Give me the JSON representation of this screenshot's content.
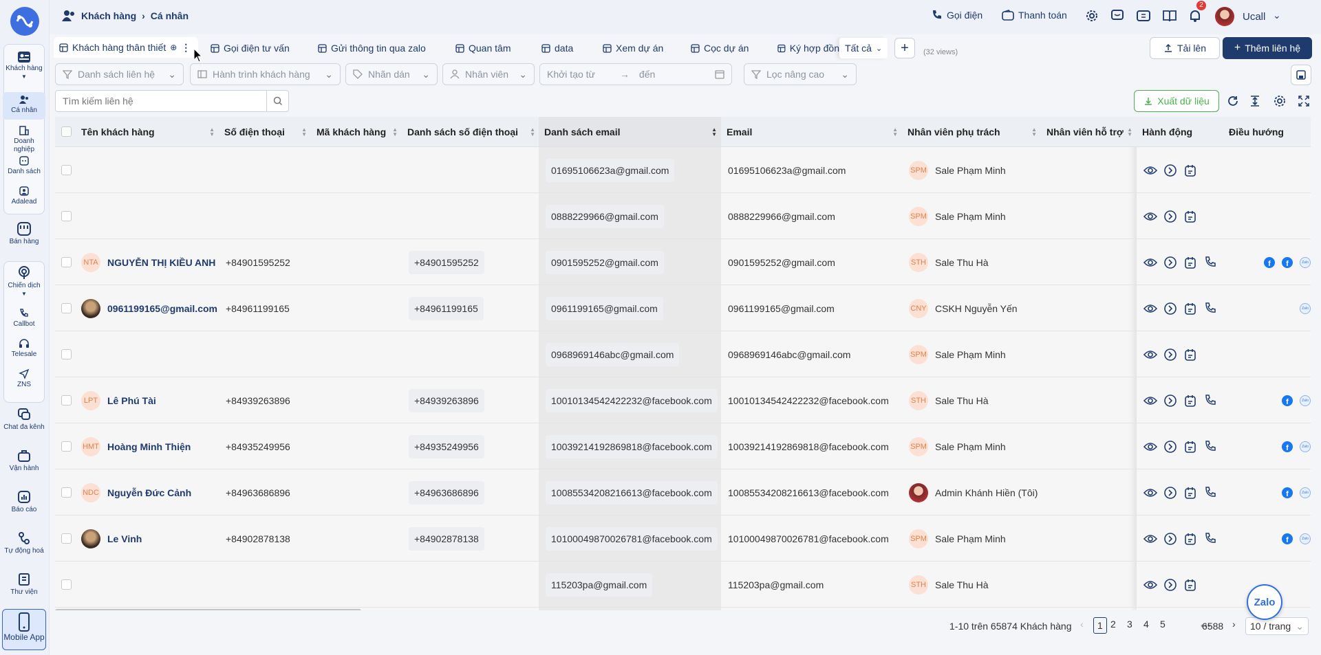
{
  "sidebar": {
    "items": [
      {
        "label": "Khách hàng",
        "icon": "contact-card-icon"
      },
      {
        "label": "Cá nhân",
        "icon": "user-icon"
      },
      {
        "label": "Doanh nghiệp",
        "icon": "building-icon"
      },
      {
        "label": "Danh sách",
        "icon": "list-icon"
      },
      {
        "label": "Adalead",
        "icon": "adalead-icon"
      },
      {
        "label": "Bán hàng",
        "icon": "shop-icon"
      },
      {
        "label": "Chiến dịch",
        "icon": "campaign-icon"
      },
      {
        "label": "Callbot",
        "icon": "phone-icon"
      },
      {
        "label": "Telesale",
        "icon": "headset-icon"
      },
      {
        "label": "ZNS",
        "icon": "send-icon"
      },
      {
        "label": "Chat đa kênh",
        "icon": "chat-icon"
      },
      {
        "label": "Vận hành",
        "icon": "briefcase-icon"
      },
      {
        "label": "Báo cáo",
        "icon": "report-icon"
      },
      {
        "label": "Tự động hoá",
        "icon": "automation-icon"
      },
      {
        "label": "Thư viện",
        "icon": "library-icon"
      },
      {
        "label": "Mobile App",
        "icon": "mobile-icon"
      }
    ]
  },
  "header": {
    "breadcrumb_root": "Khách hàng",
    "breadcrumb_current": "Cá nhân",
    "call_label": "Gọi điện",
    "payment_label": "Thanh toán",
    "notification_count": "2",
    "user_name": "Ucall"
  },
  "tabs": [
    {
      "label": "Khách hàng thân thiết"
    },
    {
      "label": "Gọi điện tư vấn"
    },
    {
      "label": "Gửi thông tin qua zalo"
    },
    {
      "label": "Quan tâm"
    },
    {
      "label": "data"
    },
    {
      "label": "Xem dự án"
    },
    {
      "label": "Cọc dự án"
    },
    {
      "label": "Ký hợp đồn"
    }
  ],
  "tabs_all_label": "Tất cả",
  "views_count": "(32 views)",
  "upload_label": "Tải lên",
  "add_contact_label": "Thêm liên hệ",
  "filters": {
    "contact_list": "Danh sách liên hệ",
    "journey": "Hành trình khách hàng",
    "tags": "Nhãn dán",
    "staff": "Nhân viên",
    "created_from": "Khởi tạo từ",
    "created_to": "đến",
    "advanced": "Lọc nâng cao"
  },
  "search": {
    "placeholder": "Tìm kiếm liên hệ"
  },
  "export_label": "Xuất dữ liệu",
  "columns": [
    "Tên khách hàng",
    "Số điện thoại",
    "Mã khách hàng",
    "Danh sách số điện thoại",
    "Danh sách email",
    "Email",
    "Nhân viên phụ trách",
    "Nhân viên hỗ trợ",
    "Hành động",
    "Điều hướng"
  ],
  "rows": [
    {
      "name": "",
      "initials": "",
      "phone": "",
      "phone_list": "",
      "email_list": "01695106623a@gmail.com",
      "email": "01695106623a@gmail.com",
      "staff_initials": "SPM",
      "staff": "Sale Phạm Minh",
      "call": false,
      "nav": ""
    },
    {
      "name": "",
      "initials": "",
      "phone": "",
      "phone_list": "",
      "email_list": "0888229966@gmail.com",
      "email": "0888229966@gmail.com",
      "staff_initials": "SPM",
      "staff": "Sale Phạm Minh",
      "call": false,
      "nav": ""
    },
    {
      "name": "NGUYỄN THỊ KIỀU ANH",
      "initials": "NTA",
      "phone": "+84901595252",
      "phone_list": "+84901595252",
      "email_list": "0901595252@gmail.com",
      "email": "0901595252@gmail.com",
      "staff_initials": "STH",
      "staff": "Sale Thu Hà",
      "call": true,
      "nav": "fb2"
    },
    {
      "name": "0961199165@gmail.com",
      "initials": "photo",
      "phone": "+84961199165",
      "phone_list": "+84961199165",
      "email_list": "0961199165@gmail.com",
      "email": "0961199165@gmail.com",
      "staff_initials": "CNY",
      "staff": "CSKH Nguyễn Yến",
      "call": true,
      "nav": "zalo"
    },
    {
      "name": "",
      "initials": "",
      "phone": "",
      "phone_list": "",
      "email_list": "0968969146abc@gmail.com",
      "email": "0968969146abc@gmail.com",
      "staff_initials": "SPM",
      "staff": "Sale Phạm Minh",
      "call": false,
      "nav": ""
    },
    {
      "name": "Lê Phú Tài",
      "initials": "LPT",
      "phone": "+84939263896",
      "phone_list": "+84939263896",
      "email_list": "100101345424222 32@facebook.com",
      "email": "10010134542422232@facebook.com",
      "staff_initials": "STH",
      "staff": "Sale Thu Hà",
      "call": true,
      "nav": "fbzalo"
    },
    {
      "name": "Hoàng Minh Thiện",
      "initials": "HMT",
      "phone": "+84935249956",
      "phone_list": "+84935249956",
      "email_list": "10039214192869818@facebook.com",
      "email": "10039214192869818@facebook.com",
      "staff_initials": "SPM",
      "staff": "Sale Phạm Minh",
      "call": true,
      "nav": "fbzalo"
    },
    {
      "name": "Nguyễn Đức Cảnh",
      "initials": "NDC",
      "phone": "+84963686896",
      "phone_list": "+84963686896",
      "email_list": "10085534208216613@facebook.com",
      "email": "10085534208216613@facebook.com",
      "staff_initials": "photo",
      "staff": "Admin Khánh Hiền (Tôi)",
      "call": true,
      "nav": "fbzalo"
    },
    {
      "name": "Le Vinh",
      "initials": "photo",
      "phone": "+84902878138",
      "phone_list": "+84902878138",
      "email_list": "10100049870026781@facebook.com",
      "email": "10100049870026781@facebook.com",
      "staff_initials": "SPM",
      "staff": "Sale Phạm Minh",
      "call": true,
      "nav": "fbzalo"
    },
    {
      "name": "",
      "initials": "",
      "phone": "",
      "phone_list": "",
      "email_list": "115203pa@gmail.com",
      "email": "115203pa@gmail.com",
      "staff_initials": "STH",
      "staff": "Sale Thu Hà",
      "call": false,
      "nav": ""
    }
  ],
  "pagination": {
    "summary": "1-10 trên 65874 Khách hàng",
    "pages": [
      "1",
      "2",
      "3",
      "4",
      "5"
    ],
    "ellipsis": "•••",
    "last": "6588",
    "page_size": "10 / trang"
  },
  "zalo_label": "Zalo",
  "colors": {
    "primary": "#1f3a6d",
    "accent_green": "#4caf50",
    "avatar_bg": "#fbe0d3"
  }
}
